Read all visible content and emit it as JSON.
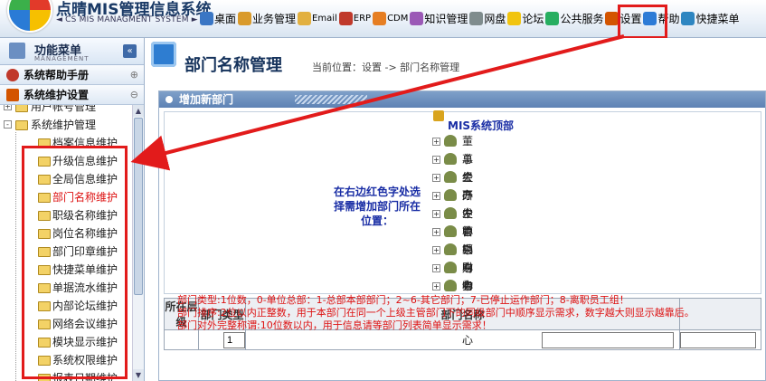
{
  "header": {
    "title": "点晴MIS管理信息系统",
    "subtitle": "◄ CS MIS MANAGMENT SYSTEM ►",
    "nav": [
      {
        "label": "桌面",
        "icon": "desktop-icon",
        "color": "#3a76c4"
      },
      {
        "label": "业务管理",
        "icon": "user-icon",
        "color": "#d99a2b"
      },
      {
        "label": "Email",
        "icon": "email-icon",
        "color": "#e2b040",
        "small": true
      },
      {
        "label": "ERP",
        "icon": "erp-icon",
        "color": "#c0392b",
        "small": true
      },
      {
        "label": "CDM",
        "icon": "cdm-icon",
        "color": "#e67e22",
        "small": true
      },
      {
        "label": "知识管理",
        "icon": "knowledge-icon",
        "color": "#9b59b6"
      },
      {
        "label": "网盘",
        "icon": "disk-icon",
        "color": "#7f8c8d"
      },
      {
        "label": "论坛",
        "icon": "forum-icon",
        "color": "#f1c40f"
      },
      {
        "label": "公共服务",
        "icon": "public-service-icon",
        "color": "#27ae60"
      },
      {
        "label": "设置",
        "icon": "settings-icon",
        "color": "#d35400"
      },
      {
        "label": "帮助",
        "icon": "help-icon",
        "color": "#2c7bd6"
      },
      {
        "label": "快捷菜单",
        "icon": "shortcut-icon",
        "color": "#2e86c1"
      }
    ]
  },
  "sidebar": {
    "title": "功能菜单",
    "title_en": "MANAGEMENT",
    "collapse": "«",
    "categories": [
      {
        "label": "系统帮助手册",
        "opt": "⊕"
      },
      {
        "label": "系统维护设置",
        "opt": "⊖"
      }
    ],
    "tree": [
      {
        "label": "用户帐号管理",
        "level": 0,
        "exp": "+"
      },
      {
        "label": "系统维护管理",
        "level": 0,
        "exp": "−"
      },
      {
        "label": "档案信息维护",
        "level": 1
      },
      {
        "label": "升级信息维护",
        "level": 1
      },
      {
        "label": "全局信息维护",
        "level": 1
      },
      {
        "label": "部门名称维护",
        "level": 1,
        "active": true
      },
      {
        "label": "职级名称维护",
        "level": 1
      },
      {
        "label": "岗位名称维护",
        "level": 1
      },
      {
        "label": "部门印章维护",
        "level": 1
      },
      {
        "label": "快捷菜单维护",
        "level": 1
      },
      {
        "label": "单据流水维护",
        "level": 1
      },
      {
        "label": "内部论坛维护",
        "level": 1
      },
      {
        "label": "网络会议维护",
        "level": 1
      },
      {
        "label": "模块显示维护",
        "level": 1
      },
      {
        "label": "系统权限维护",
        "level": 1
      },
      {
        "label": "报表日期维护",
        "level": 1
      }
    ]
  },
  "main": {
    "title": "部门名称管理",
    "location": "当前位置：设置 -> 部门名称管理",
    "panel_title": "增加新部门",
    "hint": "在右边红色字处选择需增加部门所在位置：",
    "root": "MIS系统顶部",
    "departments": [
      "董事会",
      "总经办",
      "生产中心",
      "研发中心",
      "企管中心",
      "营销中心",
      "采购中心",
      "财务中心",
      "物流中心"
    ],
    "table": {
      "col_level": "所在层级",
      "col_type": "部门类型",
      "col_name": "部门名称",
      "type_value": "1"
    },
    "notes": [
      {
        "key": "部门类型:",
        "value": "1位数，0-单位总部：1-总部本部部门；2~6-其它部门；7-已停止运作部门；8-离职员工组！"
      },
      {
        "key": "部门排序:",
        "value": "2位以内正整数，用于本部门在同一个上级主管部门下的同级部门中顺序显示需求，数字越大则显示越靠后。"
      },
      {
        "key": "部门对外完整称谓:",
        "value": "10位数以内，用于信息请等部门列表简单显示需求！"
      }
    ]
  }
}
